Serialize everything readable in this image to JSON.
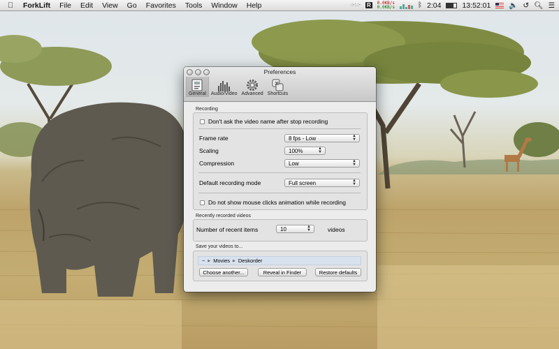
{
  "menubar": {
    "app_name": "ForkLift",
    "menus": [
      "File",
      "Edit",
      "View",
      "Go",
      "Favorites",
      "Tools",
      "Window",
      "Help"
    ],
    "net_up": "0.0KB/s",
    "net_down": "0.0KB/s",
    "status_dots": "·:-:·:-",
    "recorder_badge": "R",
    "battery_time": "2:04",
    "clock": "13:52:01"
  },
  "window": {
    "title": "Preferences",
    "tabs": [
      {
        "label": "General",
        "icon": "general-icon",
        "active": true
      },
      {
        "label": "Audio/Video",
        "icon": "audio-video-icon",
        "active": false
      },
      {
        "label": "Advanced",
        "icon": "advanced-gear-icon",
        "active": false
      },
      {
        "label": "Shortcuts",
        "icon": "shortcuts-icon",
        "active": false
      }
    ]
  },
  "recording": {
    "section_label": "Recording",
    "ask_video_name": "Don't ask the video name after stop recording",
    "frame_rate_label": "Frame rate",
    "frame_rate_value": "8 fps - Low",
    "scaling_label": "Scaling",
    "scaling_value": "100%",
    "compression_label": "Compression",
    "compression_value": "Low",
    "default_mode_label": "Default recording mode",
    "default_mode_value": "Full screen",
    "mouse_clicks_label": "Do not show mouse clicks animation while recording"
  },
  "recent": {
    "section_label": "Recently recorded videos",
    "count_label": "Number of recent items",
    "count_value": "10",
    "unit": "videos"
  },
  "save": {
    "section_label": "Save your videos to...",
    "path_home": "~",
    "path_movies": "Movies",
    "path_folder": "Deskorder",
    "choose_button": "Choose another...",
    "reveal_button": "Reveal in Finder",
    "restore_button": "Restore defaults"
  }
}
